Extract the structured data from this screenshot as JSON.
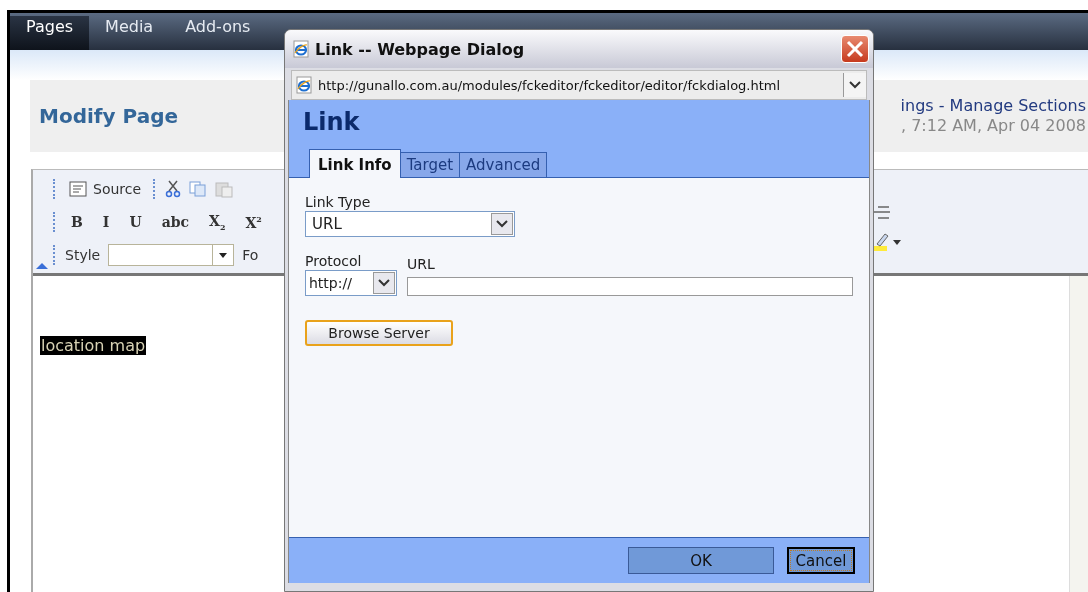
{
  "menu": [
    {
      "label": "Pages",
      "selected": true
    },
    {
      "label": "Media",
      "selected": false
    },
    {
      "label": "Add-ons",
      "selected": false
    }
  ],
  "page_header": {
    "title": "Modify Page",
    "links": "ings - Manage Sections",
    "modified": ", 7:12 AM, Apr 04 2008"
  },
  "editor": {
    "source_label": "Source",
    "format_buttons": [
      "B",
      "I",
      "U",
      "abc",
      "X$_{2}$",
      "X$^{2}$"
    ],
    "style_label": "Style",
    "font_label": "Fo",
    "content": "location map"
  },
  "dialog": {
    "title": "Link -- Webpage Dialog",
    "address": "http://gunallo.com.au/modules/fckeditor/fckeditor/editor/fckdialog.html",
    "heading": "Link",
    "tabs": [
      {
        "label": "Link Info",
        "selected": true
      },
      {
        "label": "Target",
        "selected": false
      },
      {
        "label": "Advanced",
        "selected": false
      }
    ],
    "link_type": {
      "label": "Link Type",
      "value": "URL"
    },
    "protocol": {
      "label": "Protocol",
      "value": "http://"
    },
    "url": {
      "label": "URL"
    },
    "browse_button": "Browse Server",
    "buttons": [
      {
        "label": "OK",
        "focused": false
      },
      {
        "label": "Cancel",
        "focused": true
      }
    ]
  }
}
